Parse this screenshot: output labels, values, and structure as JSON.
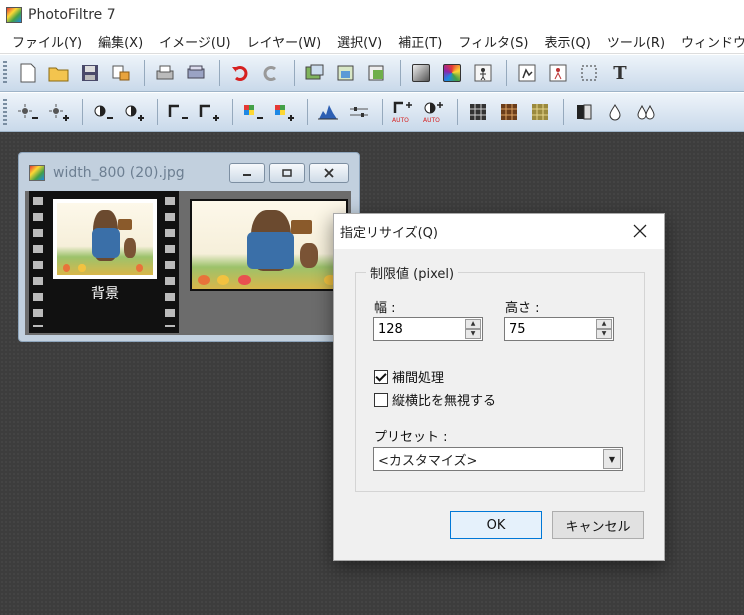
{
  "app": {
    "title": "PhotoFiltre 7"
  },
  "menu": [
    "ファイル(Y)",
    "編集(X)",
    "イメージ(U)",
    "レイヤー(W)",
    "選択(V)",
    "補正(T)",
    "フィルタ(S)",
    "表示(Q)",
    "ツール(R)",
    "ウィンドウ(P)"
  ],
  "toolbar1": {
    "text_tool_glyph": "T"
  },
  "document": {
    "filename": "width_800 (20).jpg",
    "layer_name": "背景"
  },
  "dialog": {
    "title": "指定リサイズ(Q)",
    "group_label": "制限値 (pixel)",
    "width_label": "幅 :",
    "width_value": "128",
    "height_label": "高さ :",
    "height_value": "75",
    "interpolation_label": "補間処理",
    "interpolation_checked": true,
    "ignore_ratio_label": "縦横比を無視する",
    "ignore_ratio_checked": false,
    "preset_label": "プリセット :",
    "preset_value": "<カスタマイズ>",
    "ok_label": "OK",
    "cancel_label": "キャンセル"
  }
}
